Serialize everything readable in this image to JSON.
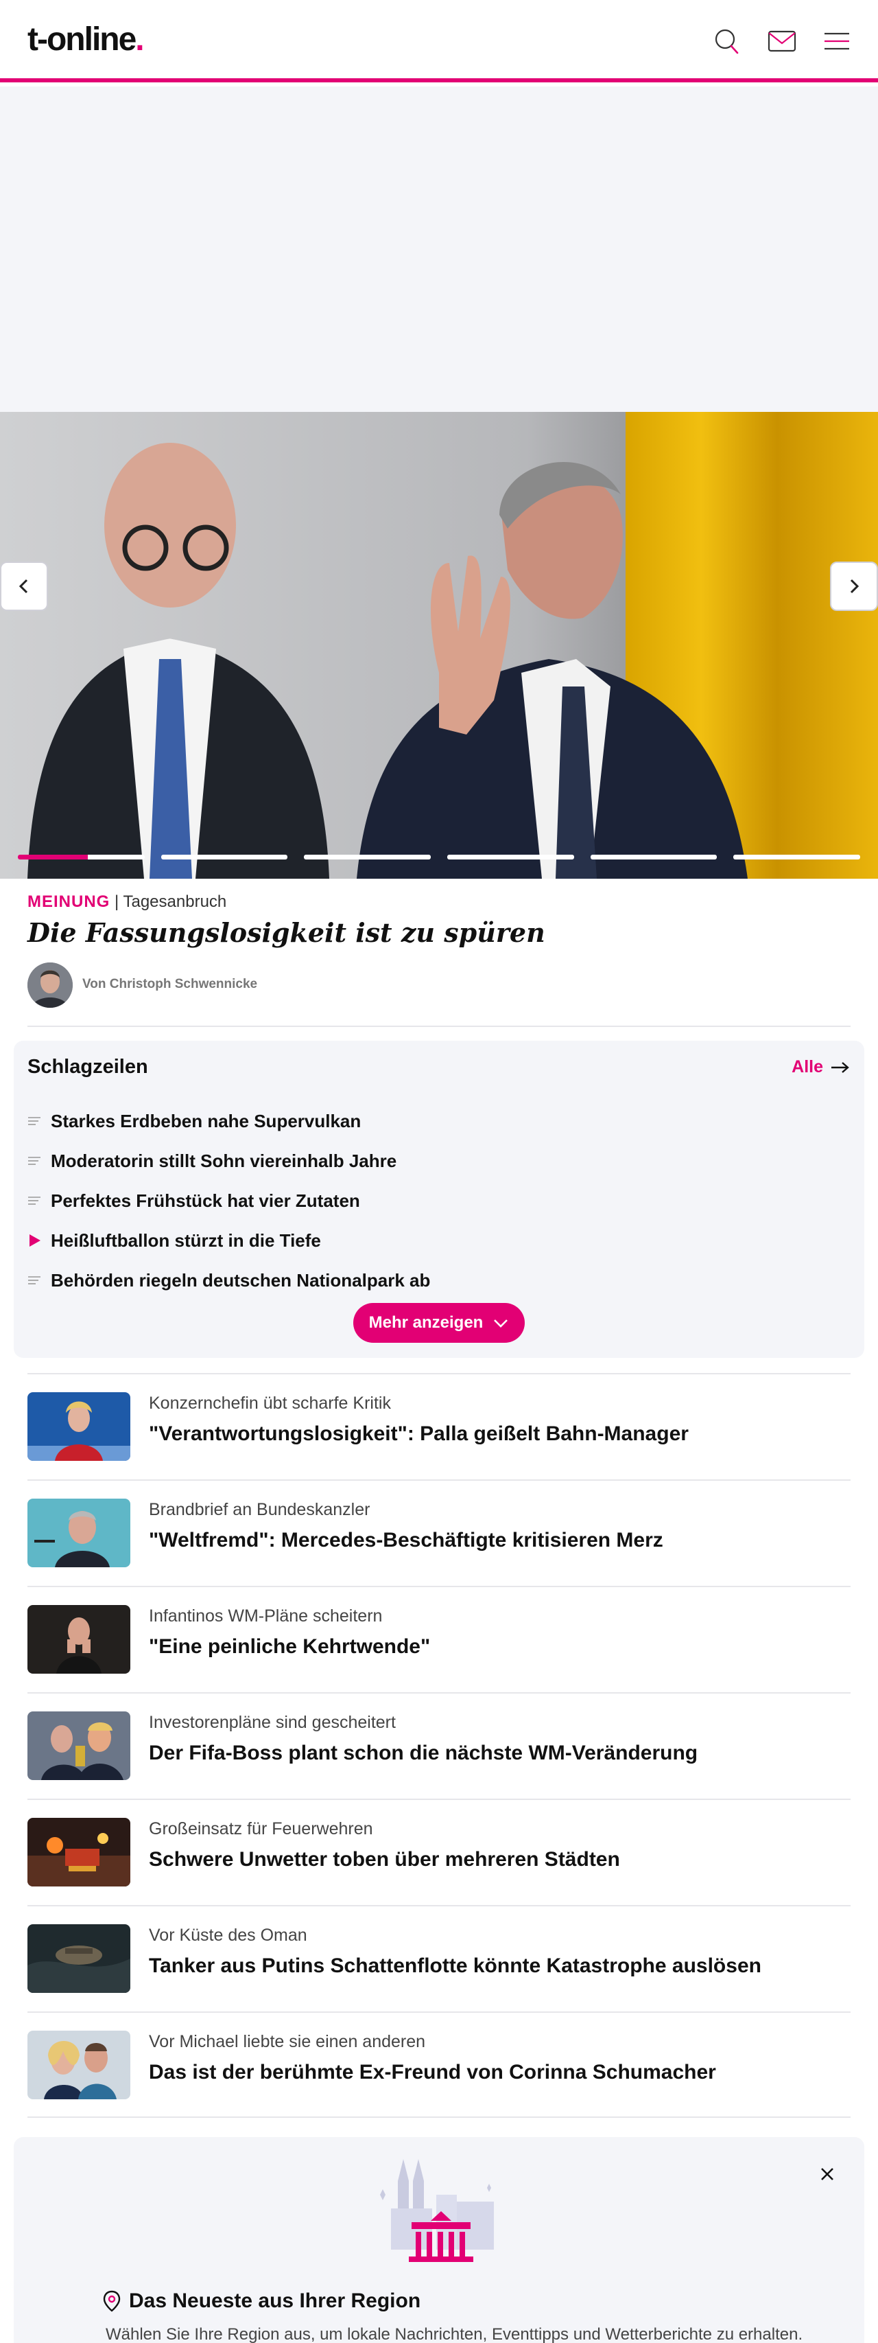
{
  "header": {
    "logo_text": "t-online",
    "logo_dot": ".",
    "icons": [
      "search-icon",
      "mail-icon",
      "menu-icon"
    ]
  },
  "colors": {
    "brand": "#e20074",
    "panel": "#f4f5f9",
    "text": "#111111"
  },
  "hero": {
    "kicker_label": "MEINUNG",
    "kicker_separator": " | ",
    "kicker_section": "Tagesanbruch",
    "title": "Die Fassungslosigkeit ist zu spüren",
    "author": "Von Christoph Schwennicke",
    "slide_count": 6,
    "active_slide_progress": 0.55
  },
  "headlines": {
    "title": "Schlagzeilen",
    "all_label": "Alle",
    "items": [
      {
        "text": "Starkes Erdbeben nahe Supervulkan",
        "icon": "article-lines-icon"
      },
      {
        "text": "Moderatorin stillt Sohn viereinhalb Jahre",
        "icon": "article-lines-icon"
      },
      {
        "text": "Perfektes Frühstück hat vier Zutaten",
        "icon": "article-lines-icon"
      },
      {
        "text": "Heißluftballon stürzt in die Tiefe",
        "icon": "video-play-icon"
      },
      {
        "text": "Behörden riegeln deutschen Nationalpark ab",
        "icon": "article-lines-icon"
      }
    ],
    "more_label": "Mehr anzeigen"
  },
  "articles": [
    {
      "kicker": "Konzernchefin übt scharfe Kritik",
      "title": "\"Verantwortungslosigkeit\": Palla geißelt Bahn-Manager"
    },
    {
      "kicker": "Brandbrief an Bundeskanzler",
      "title": "\"Weltfremd\": Mercedes-Beschäftigte kritisieren Merz"
    },
    {
      "kicker": "Infantinos WM-Pläne scheitern",
      "title": "\"Eine peinliche Kehrtwende\""
    },
    {
      "kicker": "Investorenpläne sind gescheitert",
      "title": "Der Fifa-Boss plant schon die nächste WM-Veränderung"
    },
    {
      "kicker": "Großeinsatz für Feuerwehren",
      "title": "Schwere Unwetter toben über mehreren Städten"
    },
    {
      "kicker": "Vor Küste des Oman",
      "title": "Tanker aus Putins Schattenflotte könnte Katastrophe auslösen"
    },
    {
      "kicker": "Vor Michael liebte sie einen anderen",
      "title": "Das ist der berühmte Ex-Freund von Corinna Schumacher"
    }
  ],
  "region": {
    "title": "Das Neueste aus Ihrer Region",
    "text": "Wählen Sie Ihre Region aus, um lokale Nachrichten, Eventtipps und Wetterberichte zu erhalten."
  }
}
